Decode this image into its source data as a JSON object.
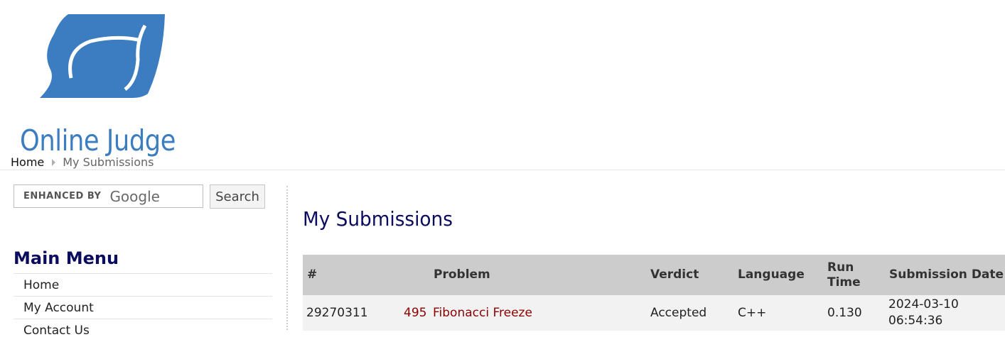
{
  "site": {
    "logo_text": "Online Judge",
    "brand_color": "#3b7dc0"
  },
  "breadcrumb": {
    "home": "Home",
    "current": "My Submissions"
  },
  "search": {
    "enhanced_by": "ENHANCED BY",
    "google": "Google",
    "button_label": "Search"
  },
  "menu": {
    "title": "Main Menu",
    "items": [
      {
        "label": "Home"
      },
      {
        "label": "My Account"
      },
      {
        "label": "Contact Us"
      }
    ]
  },
  "main": {
    "title": "My Submissions",
    "table": {
      "headers": {
        "id": "#",
        "problem": "Problem",
        "verdict": "Verdict",
        "language": "Language",
        "run_time_1": "Run",
        "run_time_2": "Time",
        "submission_date": "Submission Date"
      },
      "rows": [
        {
          "id": "29270311",
          "problem_number": "495",
          "problem_name": "Fibonacci Freeze",
          "verdict": "Accepted",
          "language": "C++",
          "run_time": "0.130",
          "date": "2024-03-10",
          "time": "06:54:36"
        }
      ]
    }
  },
  "colors": {
    "heading": "#0b0b60",
    "link": "#8b0000",
    "table_header_bg": "#cccccc",
    "row_bg": "#f2f2f2"
  }
}
